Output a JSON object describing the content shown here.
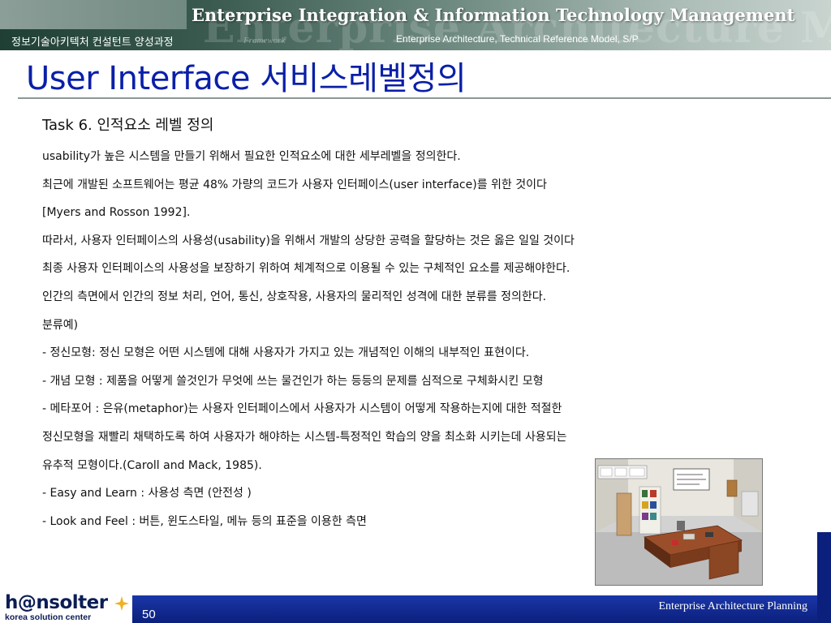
{
  "header": {
    "main_title": "Enterprise Integration & Information Technology Management",
    "ghost_text": "Enterprise Architecture Mod",
    "ghost_small": "Framework",
    "ghost_small2": "Ptech Framework",
    "course": "정보기술아키텍처 컨설턴트 양성과정",
    "topic": "Enterprise Architecture, Technical Reference Model, S/P"
  },
  "slide_title": "User Interface 서비스레벨정의",
  "task_heading": "Task 6. 인적요소  레벨 정의",
  "lines": [
    " usability가 높은 시스템을 만들기 위해서 필요한 인적요소에 대한 세부레벨을 정의한다.",
    "최근에 개발된 소프트웨어는 평균 48% 가량의 코드가 사용자 인터페이스(user interface)를 위한 것이다",
    "[Myers and Rosson 1992].",
    "따라서, 사용자 인터페이스의 사용성(usability)을 위해서 개발의 상당한 공력을 할당하는 것은 옳은 일일 것이다",
    "최종 사용자 인터페이스의 사용성을 보장하기 위하여 체계적으로 이용될 수 있는 구체적인 요소를 제공해야한다.",
    "인간의 측면에서 인간의 정보 처리, 언어, 통신, 상호작용, 사용자의 물리적인 성격에 대한 분류를 정의한다.",
    "분류예)",
    " - 정신모형: 정신 모형은 어떤 시스템에 대해 사용자가 가지고 있는 개념적인 이해의 내부적인 표현이다.",
    " - 개념 모형 : 제품을 어떻게 쓸것인가 무엇에 쓰는 물건인가 하는 등등의 문제를 심적으로 구체화시킨 모형",
    " - 메타포어  : 은유(metaphor)는 사용자 인터페이스에서 사용자가 시스템이 어떻게 작용하는지에 대한 적절한",
    "   정신모형을 재빨리 채택하도록 하여 사용자가 해야하는 시스템-특정적인 학습의 양을 최소화 시키는데 사용되는",
    "   유추적 모형이다.(Caroll and Mack, 1985).",
    " - Easy and Learn  : 사용성 측면 (안전성 )",
    " - Look and Feel : 버튼, 윈도스타일, 메뉴 등의 표준을 이용한 측면"
  ],
  "logo": {
    "name": "h@nsolter",
    "tagline": "korea solution center"
  },
  "footer": {
    "page_number": "50",
    "label": "Enterprise Architecture Planning"
  },
  "colors": {
    "title": "#0a1fa8",
    "footer_bar": "#0b1f7c",
    "logo": "#0c1d55"
  }
}
